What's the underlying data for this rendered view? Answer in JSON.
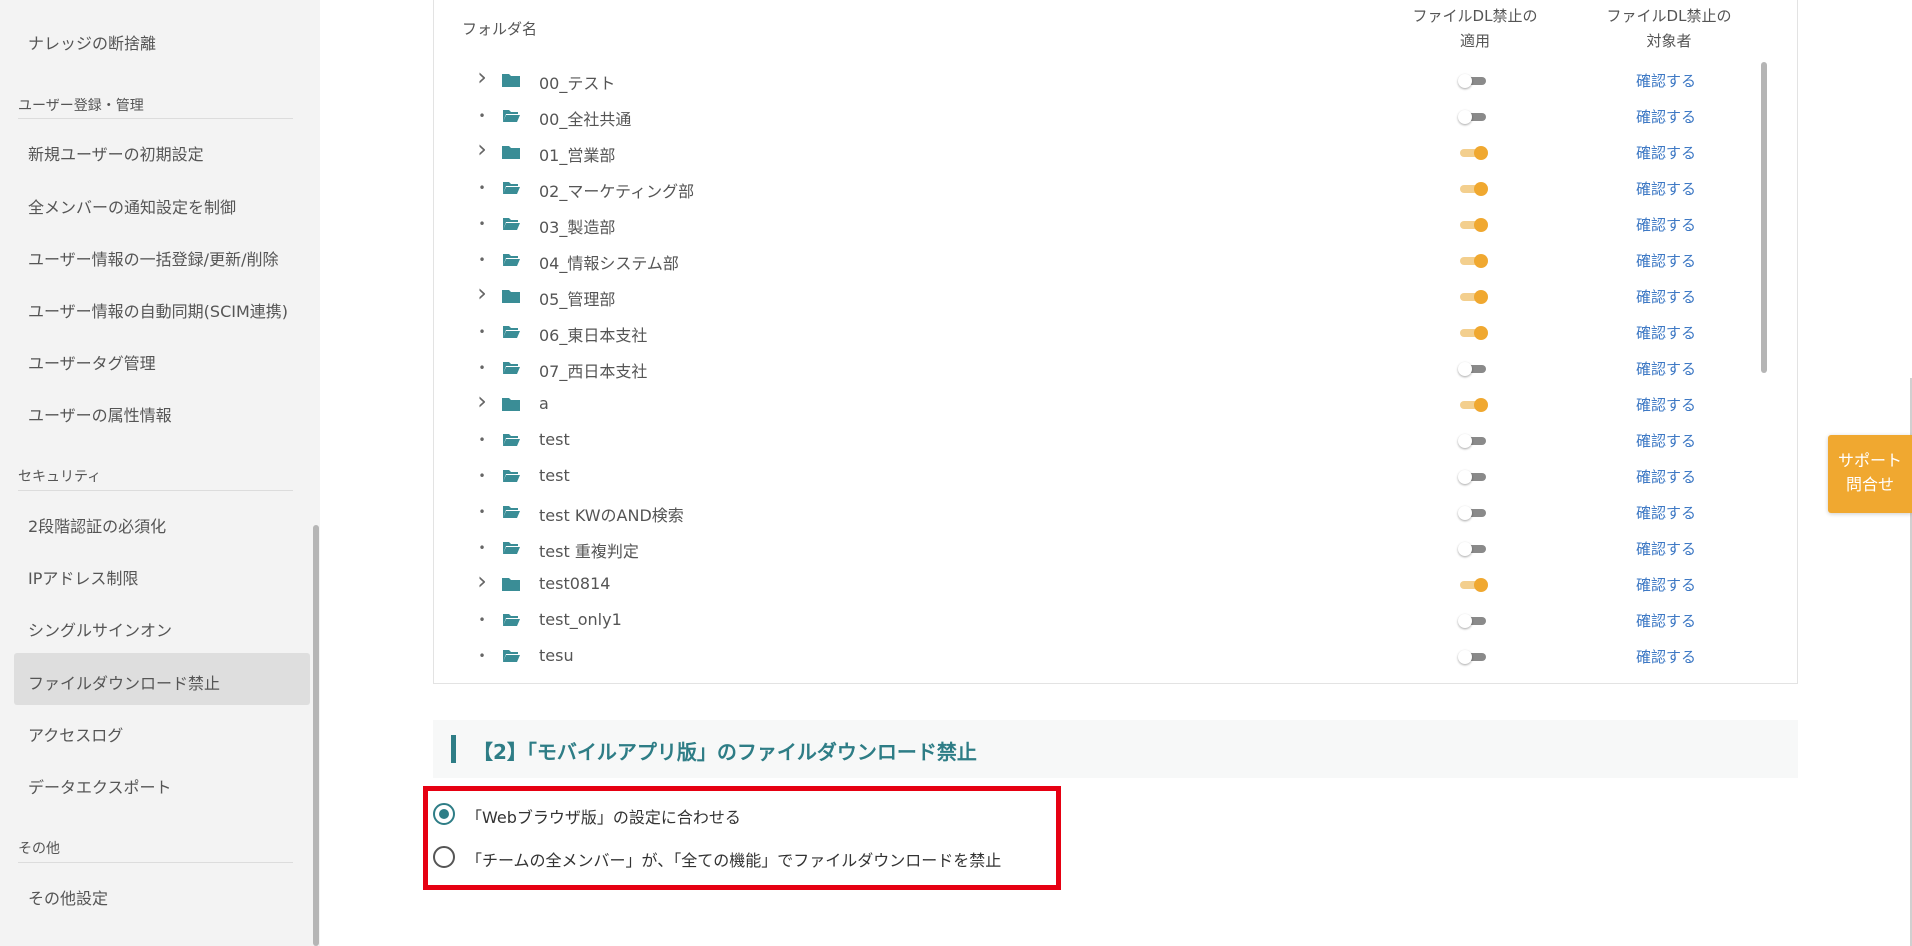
{
  "sidebar": {
    "items_top": [
      {
        "label": "ナレッジの断捨離"
      }
    ],
    "sections": [
      {
        "title": "ユーザー登録・管理",
        "items": [
          {
            "label": "新規ユーザーの初期設定"
          },
          {
            "label": "全メンバーの通知設定を制御"
          },
          {
            "label": "ユーザー情報の一括登録/更新/削除"
          },
          {
            "label": "ユーザー情報の自動同期(SCIM連携)"
          },
          {
            "label": "ユーザータグ管理"
          },
          {
            "label": "ユーザーの属性情報"
          }
        ]
      },
      {
        "title": "セキュリティ",
        "items": [
          {
            "label": "2段階認証の必須化"
          },
          {
            "label": "IPアドレス制限"
          },
          {
            "label": "シングルサインオン"
          },
          {
            "label": "ファイルダウンロード禁止",
            "active": true
          },
          {
            "label": "アクセスログ"
          },
          {
            "label": "データエクスポート"
          }
        ]
      },
      {
        "title": "その他",
        "items": [
          {
            "label": "その他設定"
          }
        ]
      }
    ]
  },
  "table": {
    "header_name": "フォルダ名",
    "header_apply": [
      "ファイルDL禁止の",
      "適用"
    ],
    "header_target": [
      "ファイルDL禁止の",
      "対象者"
    ],
    "link_label": "確認する",
    "rows": [
      {
        "name": "00_テスト",
        "expandable": true,
        "open": false,
        "enabled": false
      },
      {
        "name": "00_全社共通",
        "expandable": false,
        "open": true,
        "enabled": false
      },
      {
        "name": "01_営業部",
        "expandable": true,
        "open": false,
        "enabled": true
      },
      {
        "name": "02_マーケティング部",
        "expandable": false,
        "open": true,
        "enabled": true
      },
      {
        "name": "03_製造部",
        "expandable": false,
        "open": true,
        "enabled": true
      },
      {
        "name": "04_情報システム部",
        "expandable": false,
        "open": true,
        "enabled": true
      },
      {
        "name": "05_管理部",
        "expandable": true,
        "open": false,
        "enabled": true
      },
      {
        "name": "06_東日本支社",
        "expandable": false,
        "open": true,
        "enabled": true
      },
      {
        "name": "07_西日本支社",
        "expandable": false,
        "open": true,
        "enabled": false
      },
      {
        "name": "a",
        "expandable": true,
        "open": false,
        "enabled": true
      },
      {
        "name": "test",
        "expandable": false,
        "open": true,
        "enabled": false
      },
      {
        "name": "test",
        "expandable": false,
        "open": true,
        "enabled": false
      },
      {
        "name": "test KWのAND検索",
        "expandable": false,
        "open": true,
        "enabled": false
      },
      {
        "name": "test 重複判定",
        "expandable": false,
        "open": true,
        "enabled": false
      },
      {
        "name": "test0814",
        "expandable": true,
        "open": false,
        "enabled": true
      },
      {
        "name": "test_only1",
        "expandable": false,
        "open": true,
        "enabled": false
      },
      {
        "name": "tesu",
        "expandable": false,
        "open": true,
        "enabled": false
      }
    ]
  },
  "section2": {
    "title": "【2】「モバイルアプリ版」のファイルダウンロード禁止",
    "options": [
      {
        "label": "「Webブラウザ版」の設定に合わせる",
        "checked": true
      },
      {
        "label": "「チームの全メンバー」が、「全ての機能」でファイルダウンロードを禁止",
        "checked": false
      }
    ]
  },
  "support": {
    "line1": "サポート",
    "line2": "問合せ"
  },
  "colors": {
    "accent": "#2e7d86",
    "toggle_on": "#f0a830",
    "link": "#3d78c4",
    "highlight_box": "#e60012"
  }
}
